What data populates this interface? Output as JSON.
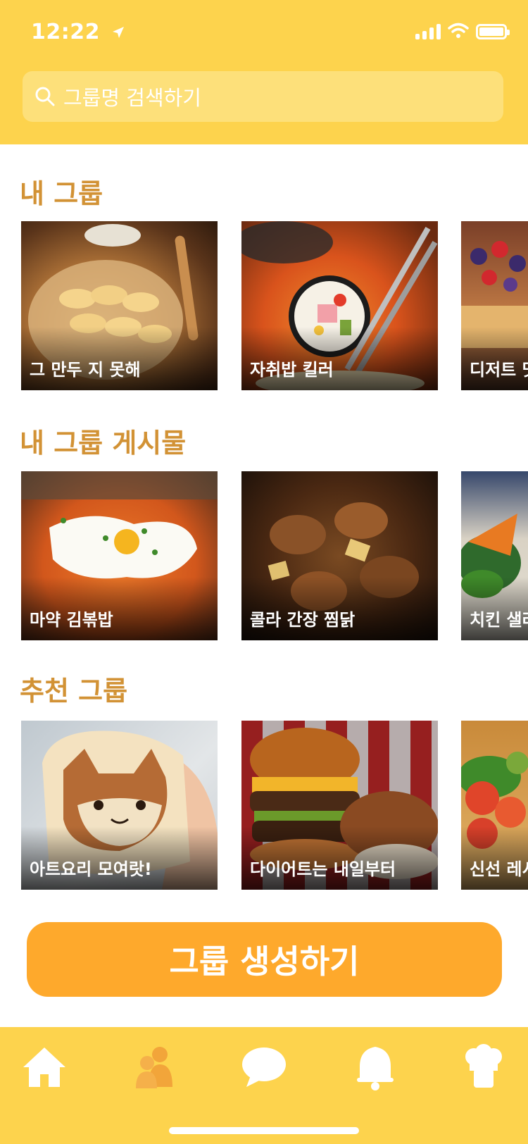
{
  "status": {
    "time": "12:22"
  },
  "search": {
    "placeholder": "그룹명 검색하기"
  },
  "sections": [
    {
      "title": "내 그룹",
      "cards": [
        {
          "label": "그 만두 지 못해"
        },
        {
          "label": "자취밥 킬러"
        },
        {
          "label": "디저트 맛"
        }
      ]
    },
    {
      "title": "내 그룹 게시물",
      "cards": [
        {
          "label": "마약 김볶밥"
        },
        {
          "label": "콜라 간장 찜닭"
        },
        {
          "label": "치킨 샐러"
        }
      ]
    },
    {
      "title": "추천 그룹",
      "cards": [
        {
          "label": "아트요리 모여랏!"
        },
        {
          "label": "다이어트는 내일부터"
        },
        {
          "label": "신선 레시"
        }
      ]
    }
  ],
  "create_button": {
    "label": "그룹 생성하기"
  },
  "tabbar": {
    "items": [
      {
        "icon": "home-icon",
        "active": false
      },
      {
        "icon": "group-icon",
        "active": true
      },
      {
        "icon": "chat-icon",
        "active": false
      },
      {
        "icon": "bell-icon",
        "active": false
      },
      {
        "icon": "chef-icon",
        "active": false
      }
    ]
  },
  "colors": {
    "header": "#FDD34D",
    "accent": "#FEA92C",
    "title": "#D29235",
    "active_tab": "#F2A53A"
  }
}
